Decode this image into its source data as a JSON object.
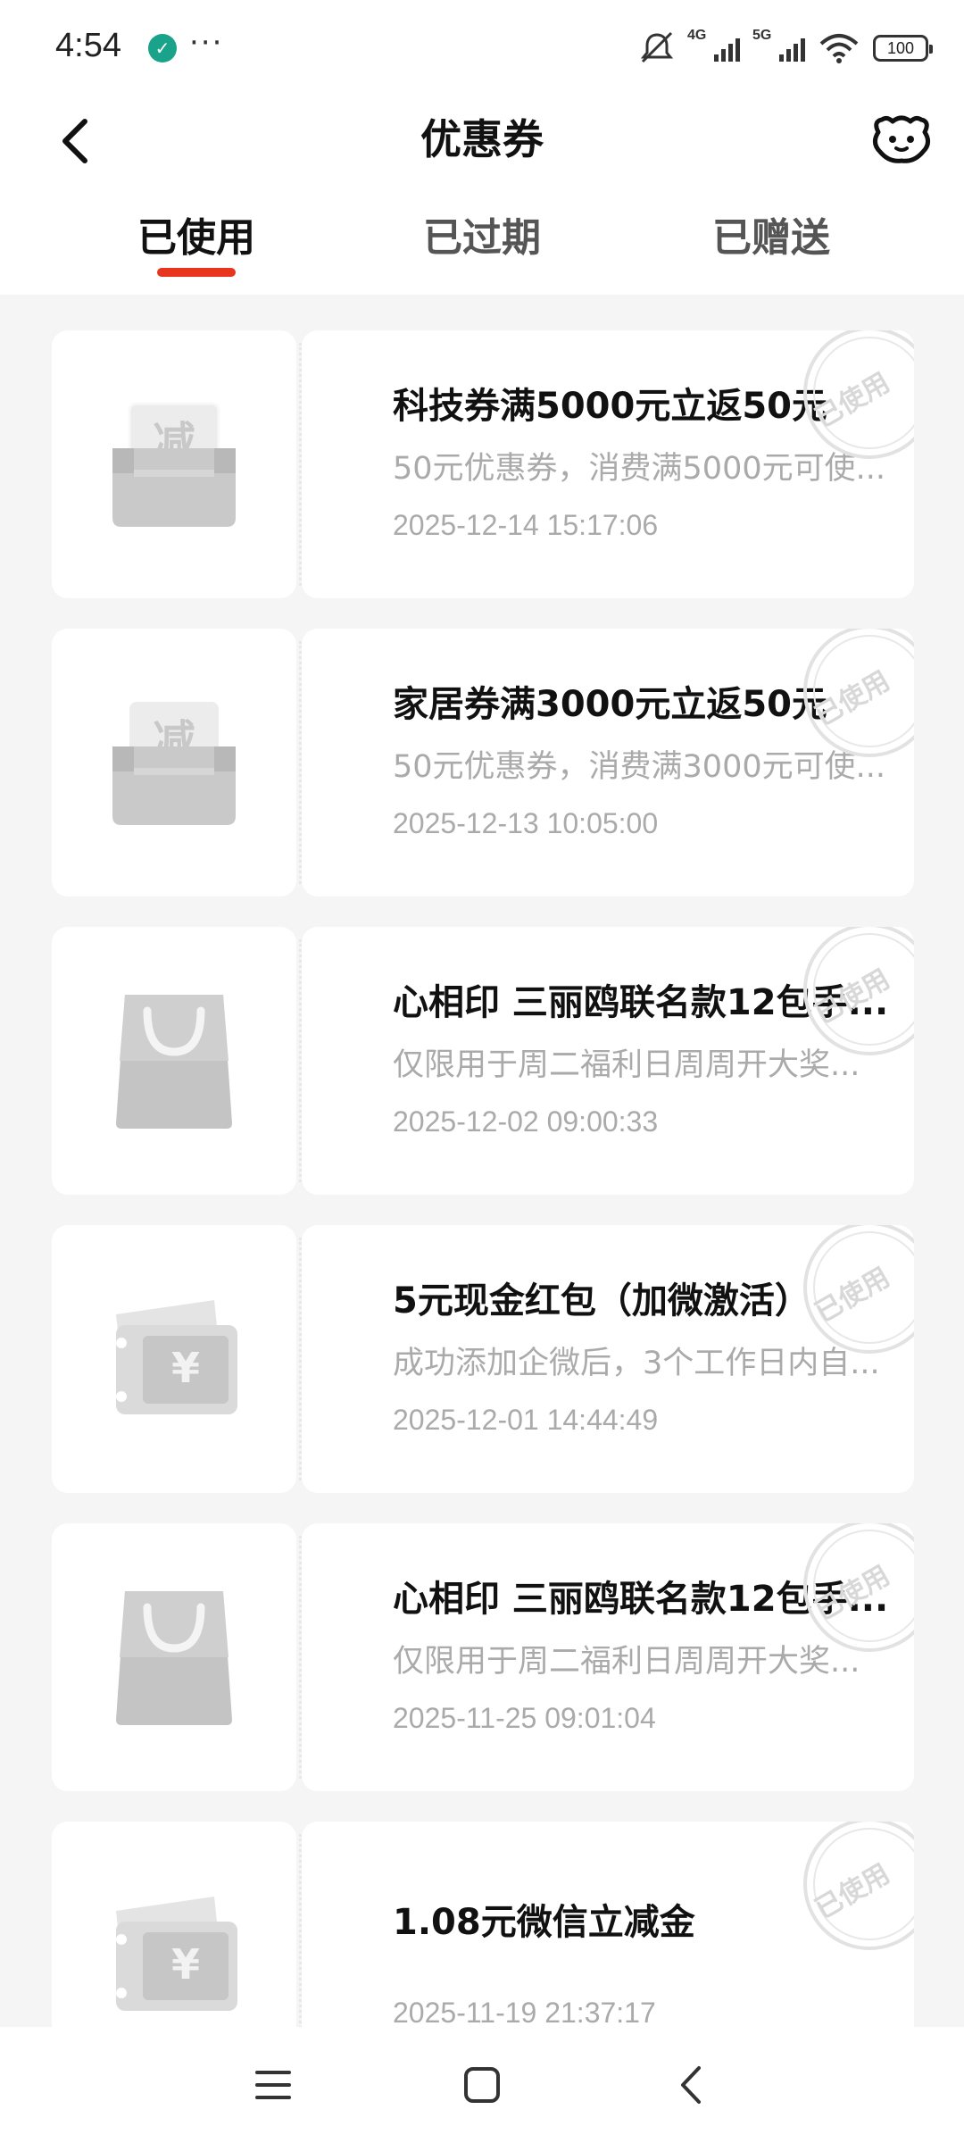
{
  "status_bar": {
    "time": "4:54",
    "app_icon": "leaf-app-icon",
    "more": "···",
    "net1": "4G",
    "net2": "5G",
    "battery": "100"
  },
  "header": {
    "title": "优惠券",
    "back_icon": "chevron-left-icon",
    "service_icon": "customer-service-mascot-icon"
  },
  "tabs": [
    {
      "label": "已使用",
      "active": true
    },
    {
      "label": "已过期",
      "active": false
    },
    {
      "label": "已赠送",
      "active": false
    }
  ],
  "accent_color": "#e8361e",
  "stamp_label": "已使用",
  "coupons": [
    {
      "title": "科技券满5000元立返50元",
      "desc": "50元优惠券，消费满5000元可使...",
      "date": "2025-12-14 15:17:06",
      "icon": "discount-tray-icon",
      "icon_text": "减"
    },
    {
      "title": "家居券满3000元立返50元",
      "desc": "50元优惠券，消费满3000元可使...",
      "date": "2025-12-13 10:05:00",
      "icon": "discount-tray-icon",
      "icon_text": "减"
    },
    {
      "title": "心相印 三丽鸥联名款12包手...",
      "desc": "仅限用于周二福利日周周开大奖...",
      "date": "2025-12-02 09:00:33",
      "icon": "shopping-bag-icon"
    },
    {
      "title": "5元现金红包（加微激活）",
      "desc": "成功添加企微后，3个工作日内自...",
      "date": "2025-12-01 14:44:49",
      "icon": "cash-ticket-icon",
      "icon_text": "¥"
    },
    {
      "title": "心相印 三丽鸥联名款12包手...",
      "desc": "仅限用于周二福利日周周开大奖...",
      "date": "2025-11-25 09:01:04",
      "icon": "shopping-bag-icon"
    },
    {
      "title": "1.08元微信立减金",
      "desc": "",
      "date": "2025-11-19 21:37:17",
      "icon": "cash-ticket-icon",
      "icon_text": "¥"
    }
  ],
  "nav": {
    "menu_icon": "menu-icon",
    "home_icon": "home-square-icon",
    "back_icon": "back-triangle-icon"
  }
}
